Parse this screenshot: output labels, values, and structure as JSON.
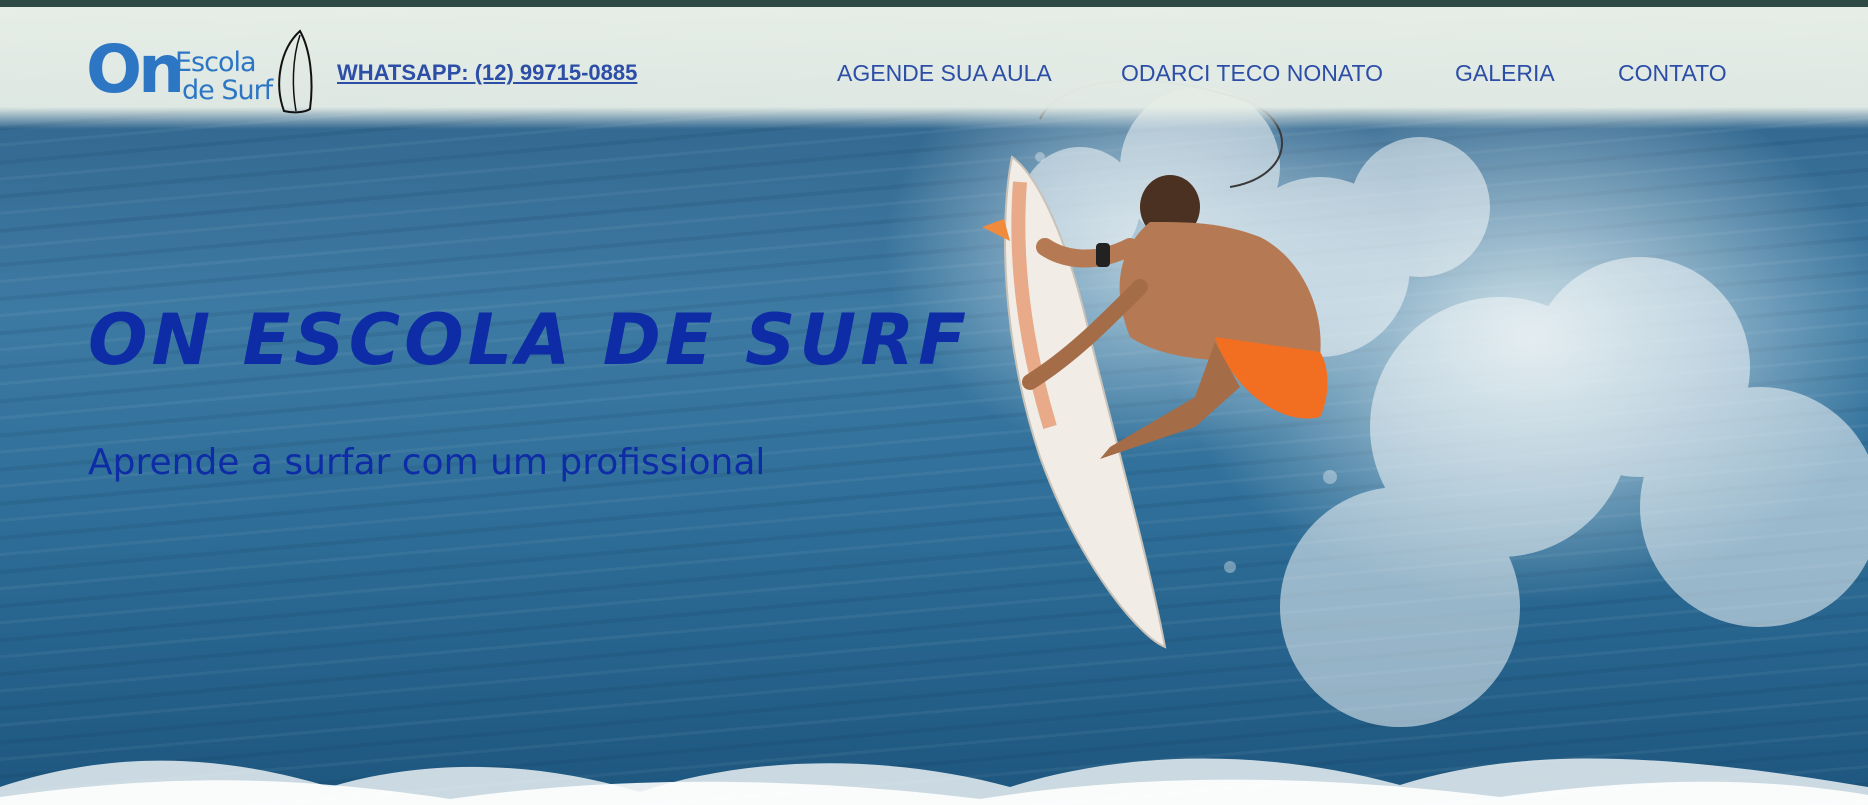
{
  "header": {
    "logo": {
      "on": "On",
      "escola": "Escola",
      "de_surf": "de Surf"
    },
    "whatsapp": "WHATSAPP: (12) 99715-0885",
    "nav": [
      {
        "label": "AGENDE SUA AULA"
      },
      {
        "label": "ODARCI TECO NONATO"
      },
      {
        "label": "GALERIA"
      },
      {
        "label": "CONTATO"
      }
    ]
  },
  "hero": {
    "title": "ON ESCOLA DE SURF",
    "subtitle": "Aprende a surfar com um profissional",
    "image_icon": "surfer-photo"
  },
  "colors": {
    "nav_text": "#2c4ea6",
    "title_text": "#0d2ca6",
    "logo_blue": "#2c76c4",
    "header_bg": "#e9efe8",
    "top_strip": "#2e4a44"
  }
}
